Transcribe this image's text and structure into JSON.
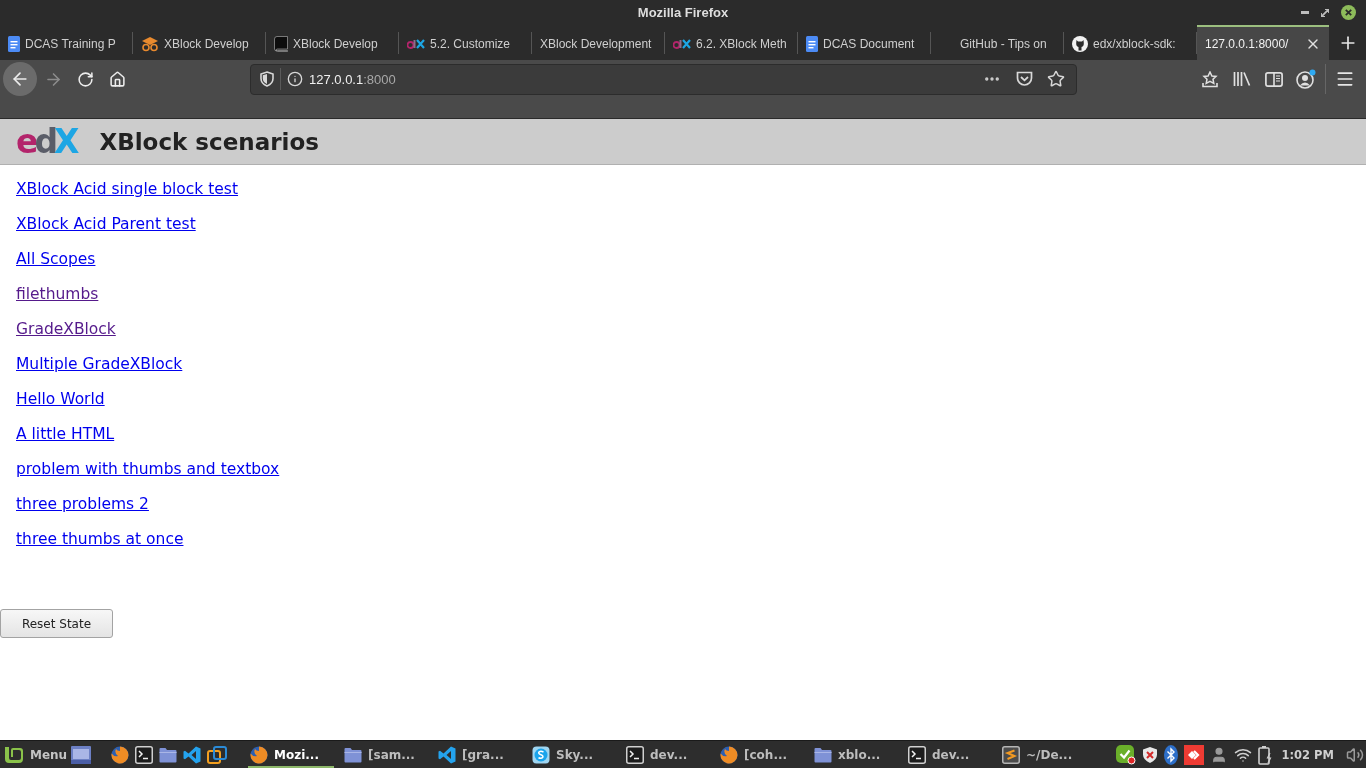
{
  "window": {
    "title": "Mozilla Firefox"
  },
  "tabs": [
    {
      "kind": "docs",
      "title": "DCAS Training P",
      "selected": false
    },
    {
      "kind": "cap",
      "title": "XBlock Develop",
      "selected": false
    },
    {
      "kind": "book",
      "title": "XBlock Develop",
      "selected": false
    },
    {
      "kind": "edx",
      "title": "5.2. Customize",
      "selected": false
    },
    {
      "kind": "none",
      "title": "XBlock Development",
      "selected": false
    },
    {
      "kind": "edx",
      "title": "6.2. XBlock Meth",
      "selected": false
    },
    {
      "kind": "docs",
      "title": "DCAS Document",
      "selected": false
    },
    {
      "kind": "blank",
      "title": "GitHub - Tips on",
      "selected": false
    },
    {
      "kind": "github",
      "title": "edx/xblock-sdk:",
      "selected": false
    },
    {
      "kind": "none",
      "title": "127.0.0.1:8000/",
      "selected": true
    }
  ],
  "toolbar": {
    "nav_buttons": [
      {
        "kind": "back",
        "disabled": false
      },
      {
        "kind": "forward",
        "disabled": true
      },
      {
        "kind": "reload",
        "disabled": false
      },
      {
        "kind": "home",
        "disabled": false
      }
    ],
    "address": {
      "host": "127.0.0.1",
      "port": ":8000"
    }
  },
  "page": {
    "logo": "edX",
    "heading": "XBlock scenarios",
    "scenarios": [
      {
        "label": "XBlock Acid single block test",
        "visited": false
      },
      {
        "label": "XBlock Acid Parent test",
        "visited": false
      },
      {
        "label": "All Scopes",
        "visited": false
      },
      {
        "label": "filethumbs",
        "visited": true
      },
      {
        "label": "GradeXBlock",
        "visited": true
      },
      {
        "label": "Multiple GradeXBlock",
        "visited": false
      },
      {
        "label": "Hello World",
        "visited": false
      },
      {
        "label": "A little HTML",
        "visited": false
      },
      {
        "label": "problem with thumbs and textbox",
        "visited": false
      },
      {
        "label": "three problems 2",
        "visited": false
      },
      {
        "label": "three thumbs at once",
        "visited": false
      }
    ],
    "reset_button": "Reset State"
  },
  "taskbar": {
    "menu_label": "Menu",
    "launchers": [
      {
        "kind": "firefox"
      },
      {
        "kind": "terminal"
      },
      {
        "kind": "folder"
      },
      {
        "kind": "vscode"
      },
      {
        "kind": "virtualbox"
      }
    ],
    "windows": [
      {
        "kind": "firefox",
        "label": "Mozi...",
        "selected": true
      },
      {
        "kind": "folder",
        "label": "[sam...",
        "selected": false
      },
      {
        "kind": "vscode",
        "label": "[gra...",
        "selected": false
      },
      {
        "kind": "skype",
        "label": "Sky...",
        "selected": false
      },
      {
        "kind": "terminal",
        "label": "dev...",
        "selected": false
      },
      {
        "kind": "firefox",
        "label": "[coh...",
        "selected": false
      },
      {
        "kind": "folder",
        "label": "xblo...",
        "selected": false
      },
      {
        "kind": "terminal",
        "label": "dev...",
        "selected": false
      },
      {
        "kind": "sublime",
        "label": "~/De...",
        "selected": false
      }
    ],
    "clock": "1:02 PM"
  }
}
